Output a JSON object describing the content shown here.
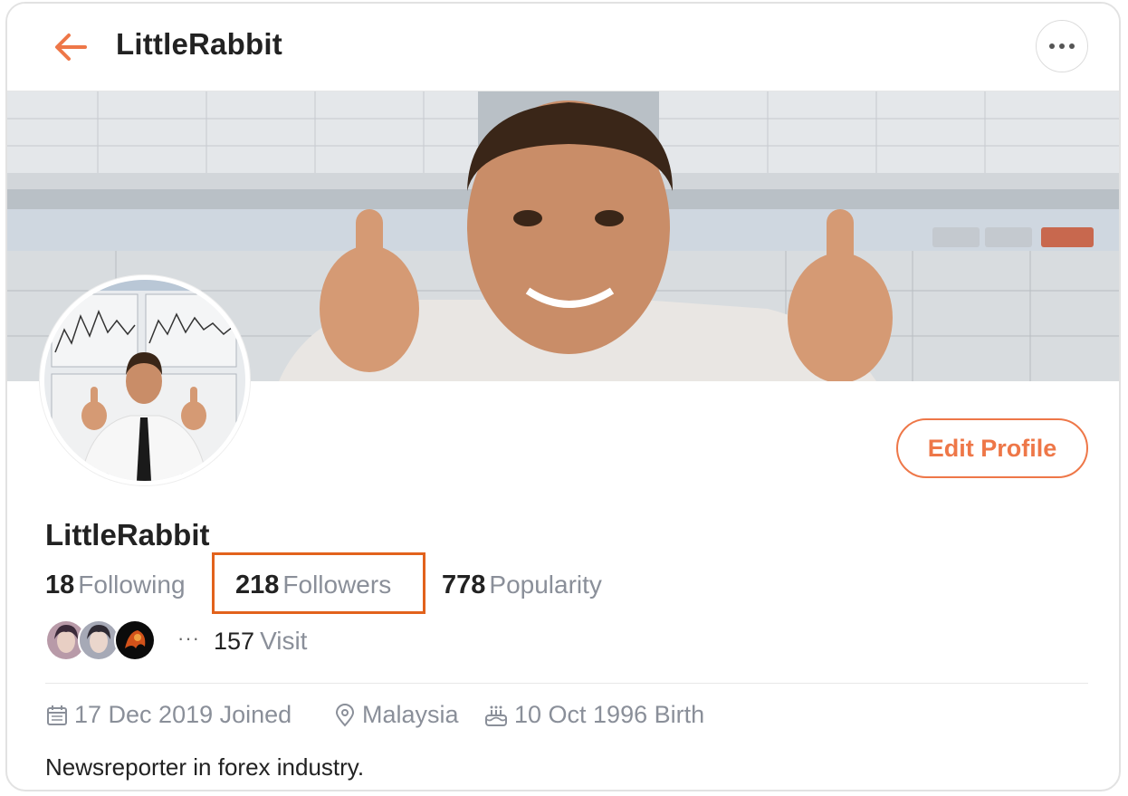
{
  "header": {
    "title": "LittleRabbit",
    "back_icon": "arrow-left-icon",
    "more_icon": "more-horizontal-icon"
  },
  "profile": {
    "name": "LittleRabbit",
    "edit_label": "Edit Profile",
    "stats": [
      {
        "value": "18",
        "label": "Following"
      },
      {
        "value": "218",
        "label": "Followers"
      },
      {
        "value": "778",
        "label": "Popularity"
      }
    ],
    "visit": {
      "more": "···",
      "count": "157",
      "label": "Visit"
    },
    "meta": {
      "joined": "17 Dec 2019 Joined",
      "location": "Malaysia",
      "birth": "10 Oct 1996 Birth"
    },
    "bio": "Newsreporter in forex industry."
  },
  "colors": {
    "accent": "#ee7748",
    "highlight": "#e2621c",
    "muted": "#8a8f99",
    "text": "#222222"
  }
}
